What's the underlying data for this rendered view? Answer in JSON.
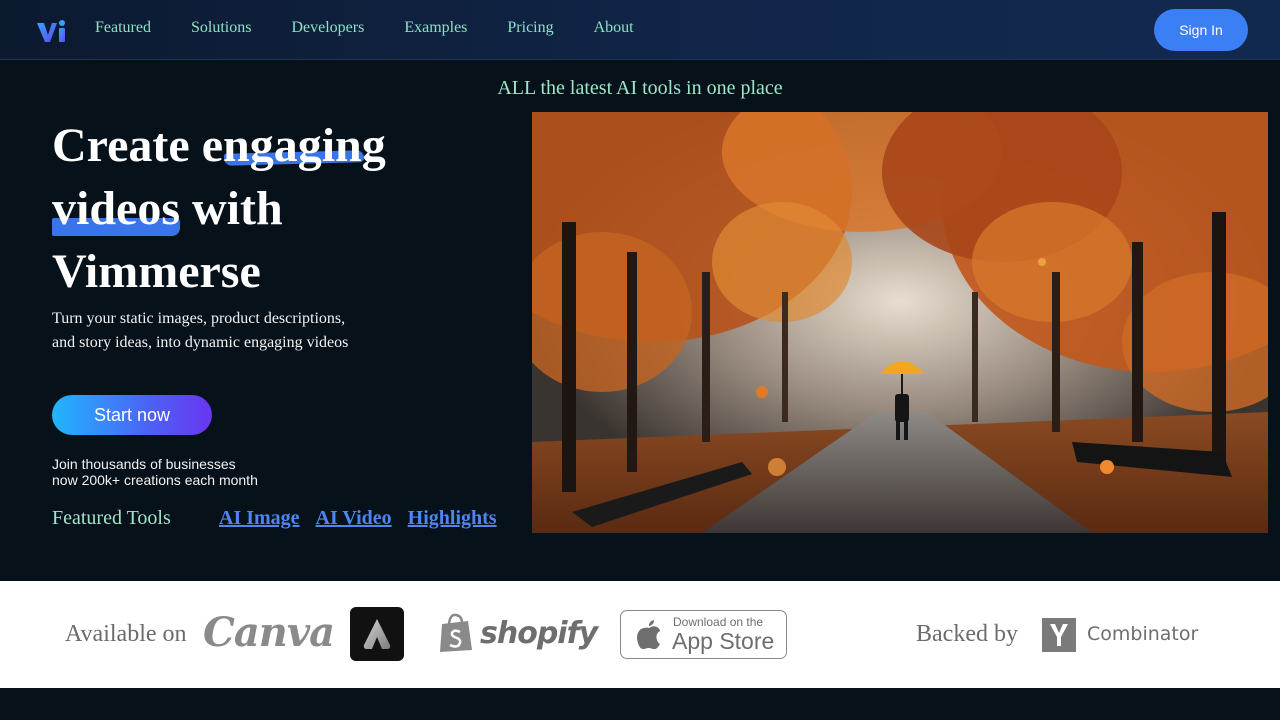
{
  "nav": {
    "logo_icon": "vimmerse-logo-icon",
    "links": [
      "Featured",
      "Solutions",
      "Developers",
      "Examples",
      "Pricing",
      "About"
    ],
    "sign_in_label": "Sign In"
  },
  "hero": {
    "tagline": "ALL the latest AI tools in one place",
    "headline": {
      "word1": "Create",
      "word2": "engaging",
      "word3": "videos",
      "word4": "with",
      "word5": "Vimmerse"
    },
    "subtext": "Turn your static images, product descriptions, and story ideas, into dynamic engaging videos",
    "cta_label": "Start now",
    "join_line1": "Join thousands of businesses",
    "join_line2": "now 200k+ creations each month",
    "featured_label": "Featured Tools",
    "featured_links": [
      "AI Image",
      "AI Video",
      "Highlights"
    ],
    "image_icon": "autumn-park-umbrella-image"
  },
  "strip": {
    "available_label": "Available on",
    "canva": "Canva",
    "adobe_icon": "adobe-express-icon",
    "shopify": "shopify",
    "appstore_small": "Download on the",
    "appstore_big": "App Store",
    "backed_label": "Backed by",
    "yc_letter": "Y",
    "yc_text": "Combinator"
  },
  "colors": {
    "background": "#06111a",
    "nav_link": "#8fe0c6",
    "accent_blue": "#3b7ff5",
    "link_blue": "#4d86f2",
    "highlight": "#3a74ea"
  }
}
